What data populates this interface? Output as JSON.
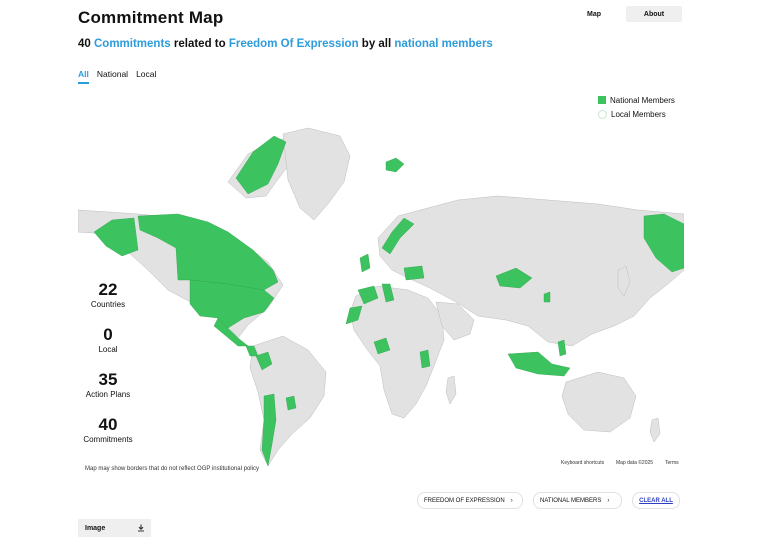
{
  "header": {
    "title": "Commitment Map",
    "nav": {
      "map_label": "Map",
      "about_label": "About"
    }
  },
  "subtitle": {
    "count": "40",
    "link1": "Commitments",
    "text1": "related to",
    "link2": "Freedom Of Expression",
    "text2": "by all",
    "link3": "national members"
  },
  "tabs": [
    {
      "label": "All",
      "active": true
    },
    {
      "label": "National",
      "active": false
    },
    {
      "label": "Local",
      "active": false
    }
  ],
  "legend": {
    "national": "National Members",
    "local": "Local Members"
  },
  "stats": [
    {
      "value": "22",
      "label": "Countries"
    },
    {
      "value": "0",
      "label": "Local"
    },
    {
      "value": "35",
      "label": "Action Plans"
    },
    {
      "value": "40",
      "label": "Commitments"
    }
  ],
  "map": {
    "disclaimer": "Map may show borders that do not reflect OGP institutional policy",
    "attribution": {
      "shortcuts": "Keyboard shortcuts",
      "data": "Map data ©2025",
      "terms": "Terms"
    }
  },
  "filters": {
    "theme": "FREEDOM OF EXPRESSION",
    "members": "NATIONAL MEMBERS",
    "clear": "CLEAR ALL",
    "chevron": "›"
  },
  "export": {
    "label": "Image"
  },
  "colors": {
    "accent": "#2d9cdb",
    "national": "#3cc35f",
    "land": "#e2e2e2",
    "border": "#bdbdbd"
  }
}
